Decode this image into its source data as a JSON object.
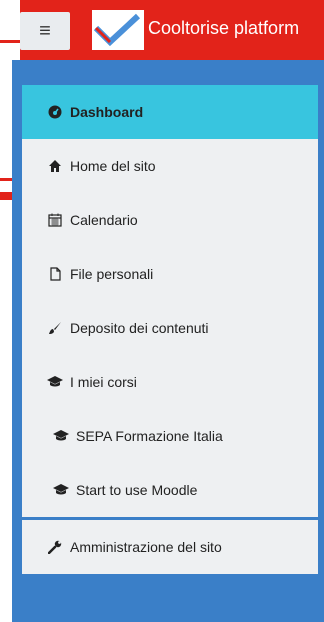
{
  "header": {
    "menu_icon": "hamburger-icon",
    "brand": "Cooltorise platform"
  },
  "nav": {
    "items": [
      {
        "label": "Dashboard",
        "icon": "dashboard-icon"
      },
      {
        "label": "Home del sito",
        "icon": "home-icon"
      },
      {
        "label": "Calendario",
        "icon": "calendar-icon"
      },
      {
        "label": "File personali",
        "icon": "file-icon"
      },
      {
        "label": "Deposito dei contenuti",
        "icon": "paintbrush-icon"
      },
      {
        "label": "I miei corsi",
        "icon": "graduation-cap-icon"
      },
      {
        "label": "SEPA Formazione Italia",
        "icon": "graduation-cap-icon"
      },
      {
        "label": "Start to use Moodle",
        "icon": "graduation-cap-icon"
      }
    ],
    "admin": {
      "label": "Amministrazione del sito",
      "icon": "wrench-icon"
    }
  },
  "colors": {
    "header": "#e2231a",
    "drawer": "#3a7fc8",
    "active": "#38c5df",
    "panel": "#eef0f2"
  }
}
